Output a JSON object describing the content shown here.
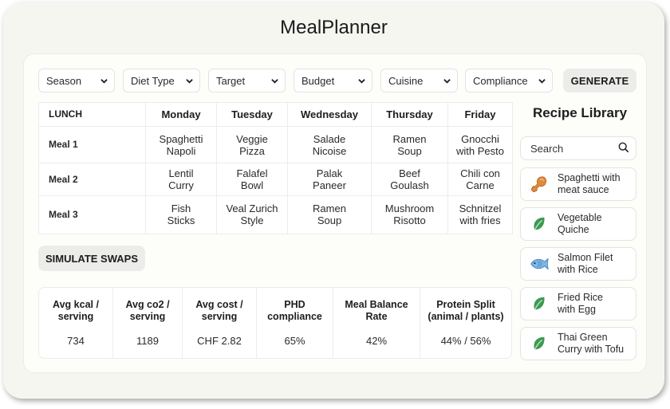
{
  "app": {
    "title": "MealPlanner"
  },
  "filters": [
    {
      "label": "Season"
    },
    {
      "label": "Diet Type"
    },
    {
      "label": "Target"
    },
    {
      "label": "Budget"
    },
    {
      "label": "Cuisine"
    },
    {
      "label": "Compliance"
    }
  ],
  "generate_label": "GENERATE",
  "meal_table": {
    "corner": "LUNCH",
    "days": [
      "Monday",
      "Tuesday",
      "Wednesday",
      "Thursday",
      "Friday"
    ],
    "rows": [
      {
        "label": "Meal 1",
        "meals": [
          [
            "Spaghetti",
            "Napoli"
          ],
          [
            "Veggie",
            "Pizza"
          ],
          [
            "Salade",
            "Nicoise"
          ],
          [
            "Ramen",
            "Soup"
          ],
          [
            "Gnocchi",
            "with Pesto"
          ]
        ]
      },
      {
        "label": "Meal 2",
        "meals": [
          [
            "Lentil",
            "Curry"
          ],
          [
            "Falafel",
            "Bowl"
          ],
          [
            "Palak",
            "Paneer"
          ],
          [
            "Beef",
            "Goulash"
          ],
          [
            "Chili con",
            "Carne"
          ]
        ]
      },
      {
        "label": "Meal 3",
        "meals": [
          [
            "Fish",
            "Sticks"
          ],
          [
            "Veal Zurich",
            "Style"
          ],
          [
            "Ramen",
            "Soup"
          ],
          [
            "Mushroom",
            "Risotto"
          ],
          [
            "Schnitzel",
            "with fries"
          ]
        ]
      }
    ]
  },
  "simulate_label": "SIMULATE SWAPS",
  "stats": [
    {
      "label": "Avg kcal /\nserving",
      "value": "734"
    },
    {
      "label": "Avg co2 /\nserving",
      "value": "1189"
    },
    {
      "label": "Avg cost /\nserving",
      "value": "CHF 2.82"
    },
    {
      "label": "PHD\ncompliance",
      "value": "65%"
    },
    {
      "label": "Meal Balance\nRate",
      "value": "42%"
    },
    {
      "label": "Protein Split\n(animal / plants)",
      "value": "44% / 56%"
    }
  ],
  "library": {
    "title": "Recipe Library",
    "search_placeholder": "Search",
    "items": [
      {
        "name": "Spaghetti with\nmeat sauce",
        "icon": "drumstick-icon"
      },
      {
        "name": "Vegetable\nQuiche",
        "icon": "leaf-icon"
      },
      {
        "name": "Salmon Filet\nwith Rice",
        "icon": "fish-icon"
      },
      {
        "name": "Fried Rice\nwith Egg",
        "icon": "leaf-icon"
      },
      {
        "name": "Thai Green\nCurry with Tofu",
        "icon": "leaf-icon"
      }
    ]
  },
  "colors": {
    "leaf": "#3d9a52",
    "drumstick": "#e08a3c",
    "fish": "#5b9bd5",
    "button_bg": "#ececea",
    "window_bg": "#f6f6f1"
  }
}
